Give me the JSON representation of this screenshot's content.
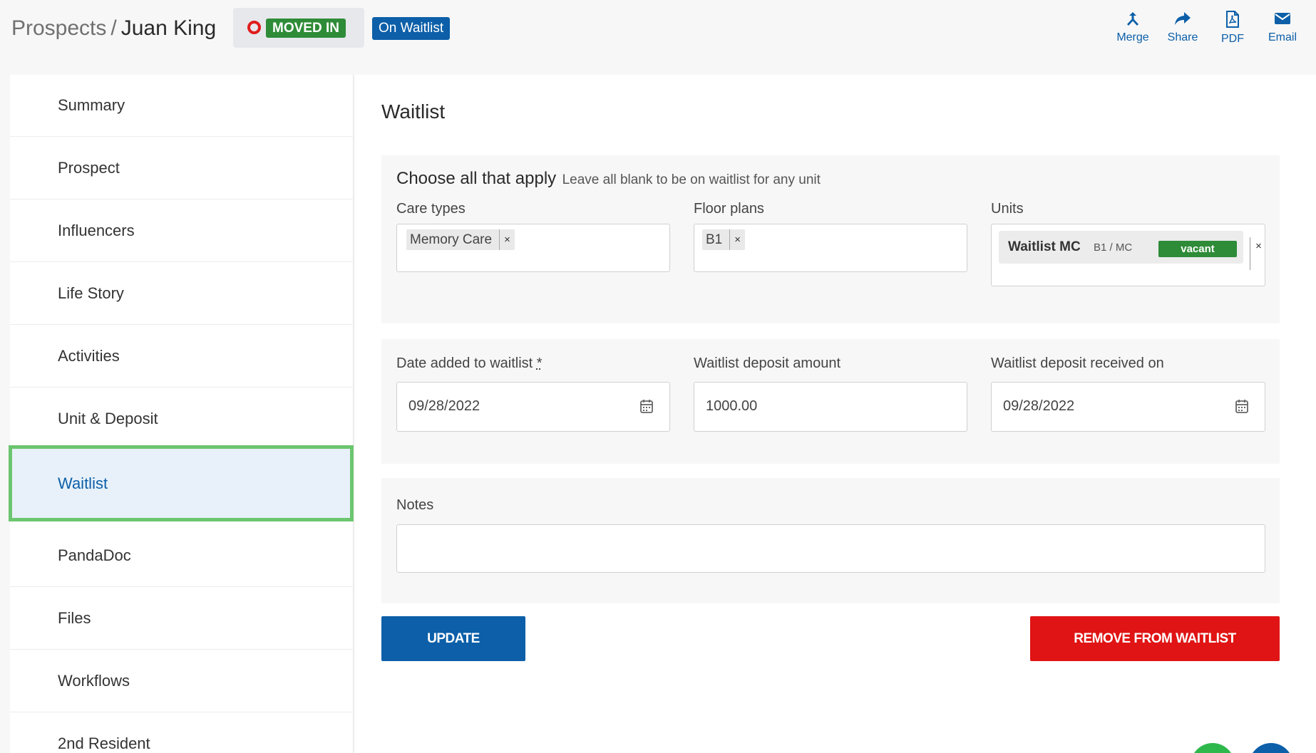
{
  "header": {
    "breadcrumb_parent": "Prospects",
    "breadcrumb_sep": "/",
    "prospect_name": "Juan King",
    "status_badge": "MOVED IN",
    "waitlist_badge": "On Waitlist",
    "actions": [
      {
        "label": "Merge",
        "icon": "merge-icon"
      },
      {
        "label": "Share",
        "icon": "share-icon"
      },
      {
        "label": "PDF",
        "icon": "pdf-icon"
      },
      {
        "label": "Email",
        "icon": "email-icon"
      }
    ]
  },
  "sidebar": {
    "active_index": 6,
    "items": [
      {
        "label": "Summary"
      },
      {
        "label": "Prospect"
      },
      {
        "label": "Influencers"
      },
      {
        "label": "Life Story"
      },
      {
        "label": "Activities"
      },
      {
        "label": "Unit & Deposit"
      },
      {
        "label": "Waitlist"
      },
      {
        "label": "PandaDoc"
      },
      {
        "label": "Files"
      },
      {
        "label": "Workflows"
      },
      {
        "label": "2nd Resident"
      }
    ]
  },
  "main": {
    "title": "Waitlist",
    "choose": {
      "heading": "Choose all that apply",
      "hint": "Leave all blank to be on waitlist for any unit",
      "care_types_label": "Care types",
      "care_types": [
        "Memory Care"
      ],
      "floor_plans_label": "Floor plans",
      "floor_plans": [
        "B1"
      ],
      "units_label": "Units",
      "unit": {
        "name": "Waitlist MC",
        "sub": "B1 / MC",
        "status": "vacant"
      }
    },
    "date_added_label": "Date added to waitlist",
    "date_added_required": "*",
    "date_added_value": "09/28/2022",
    "deposit_amount_label": "Waitlist deposit amount",
    "deposit_amount_value": "1000.00",
    "deposit_received_label": "Waitlist deposit received on",
    "deposit_received_value": "09/28/2022",
    "notes_label": "Notes",
    "notes_value": "",
    "update_button": "UPDATE",
    "remove_button": "REMOVE FROM WAITLIST"
  },
  "colors": {
    "primary": "#0c5fa8",
    "success": "#2e8b37",
    "danger": "#e01414",
    "active_outline": "#6cc56f"
  }
}
